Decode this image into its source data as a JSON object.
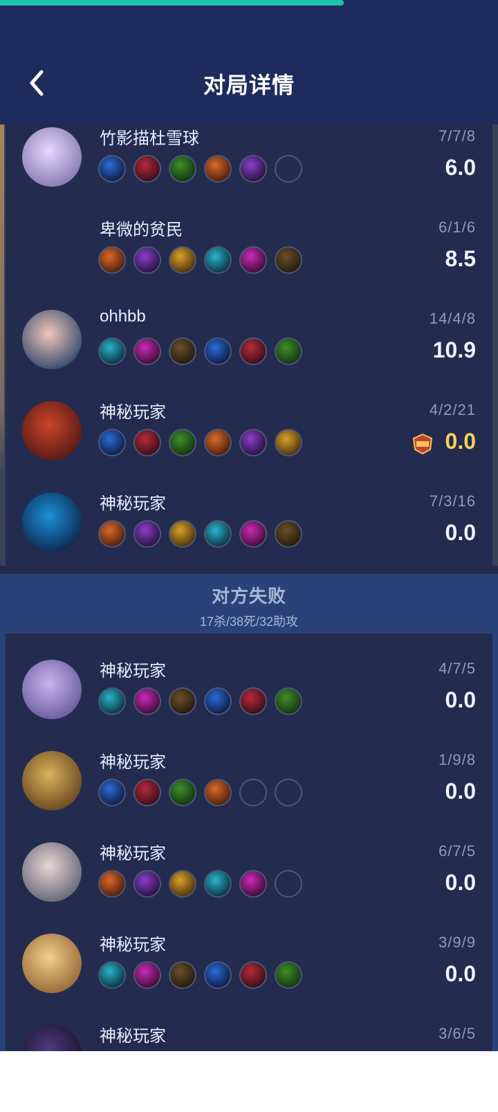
{
  "header": {
    "title": "对局详情",
    "progress_fraction": 0.69
  },
  "colors": {
    "header": "#1d2c5c",
    "body": "#232c4f",
    "mvp_gold": "#f8d25a",
    "progress": "#1fc2b0"
  },
  "team_win": {
    "players": [
      {
        "name": "竹影描杜雪球",
        "kda": "7/7/8",
        "score": "6.0",
        "avatar": "hero-portrait",
        "items": 5
      },
      {
        "name": "卑微的贫民",
        "kda": "6/1/6",
        "score": "8.5",
        "avatar": "none",
        "items": 6
      },
      {
        "name": "ohhbb",
        "kda": "14/4/8",
        "score": "10.9",
        "avatar": "hero-portrait",
        "items": 6
      },
      {
        "name": "神秘玩家",
        "kda": "4/2/21",
        "score": "0.0",
        "avatar": "hero-portrait",
        "items": 6,
        "mvp": true
      },
      {
        "name": "神秘玩家",
        "kda": "7/3/16",
        "score": "0.0",
        "avatar": "hero-portrait",
        "items": 6
      }
    ]
  },
  "team_lose": {
    "title": "对方失败",
    "summary": "17杀/38死/32助攻",
    "players": [
      {
        "name": "神秘玩家",
        "kda": "4/7/5",
        "score": "0.0",
        "avatar": "hero-portrait",
        "items": 6
      },
      {
        "name": "神秘玩家",
        "kda": "1/9/8",
        "score": "0.0",
        "avatar": "hero-portrait",
        "items": 4
      },
      {
        "name": "神秘玩家",
        "kda": "6/7/5",
        "score": "0.0",
        "avatar": "hero-portrait",
        "items": 5
      },
      {
        "name": "神秘玩家",
        "kda": "3/9/9",
        "score": "0.0",
        "avatar": "hero-portrait",
        "items": 6
      },
      {
        "name": "神秘玩家",
        "kda": "3/6/5",
        "score": "",
        "avatar": "hero-portrait",
        "items": 6
      }
    ]
  }
}
